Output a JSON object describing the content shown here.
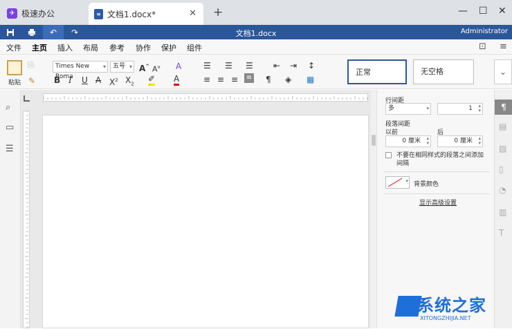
{
  "app": {
    "title": "极速办公",
    "logo_glyph": "🚀"
  },
  "doc_tab": {
    "title": "文档1.docx*",
    "doc_glyph": "≡"
  },
  "window": {
    "minimize": "—",
    "maximize": "☐",
    "close": "✕",
    "newtab": "+"
  },
  "titlebar": {
    "doc_title": "文档1.docx",
    "user": "Administrator",
    "color": "#2b579a"
  },
  "menus": [
    "文件",
    "主页",
    "插入",
    "布局",
    "参考",
    "协作",
    "保护",
    "组件"
  ],
  "ribbon": {
    "paste_label": "粘贴",
    "font_name": "Times New Roma",
    "font_size": "五号",
    "styles": [
      "正常",
      "无空格"
    ]
  },
  "panel": {
    "line_spacing_label": "行间距",
    "line_spacing_mode": "多",
    "line_spacing_value": "1",
    "para_spacing_label": "段落间距",
    "before_label": "以前",
    "after_label": "后",
    "before_value": "0 厘米",
    "after_value": "0 厘米",
    "no_space_checkbox": "不要在相同样式的段落之间添加间隔",
    "bg_color_label": "背景颜色",
    "advanced_link": "显示高级设置"
  },
  "watermark": {
    "big": "系统之家",
    "small": "XITONGZHIJIA.NET"
  }
}
